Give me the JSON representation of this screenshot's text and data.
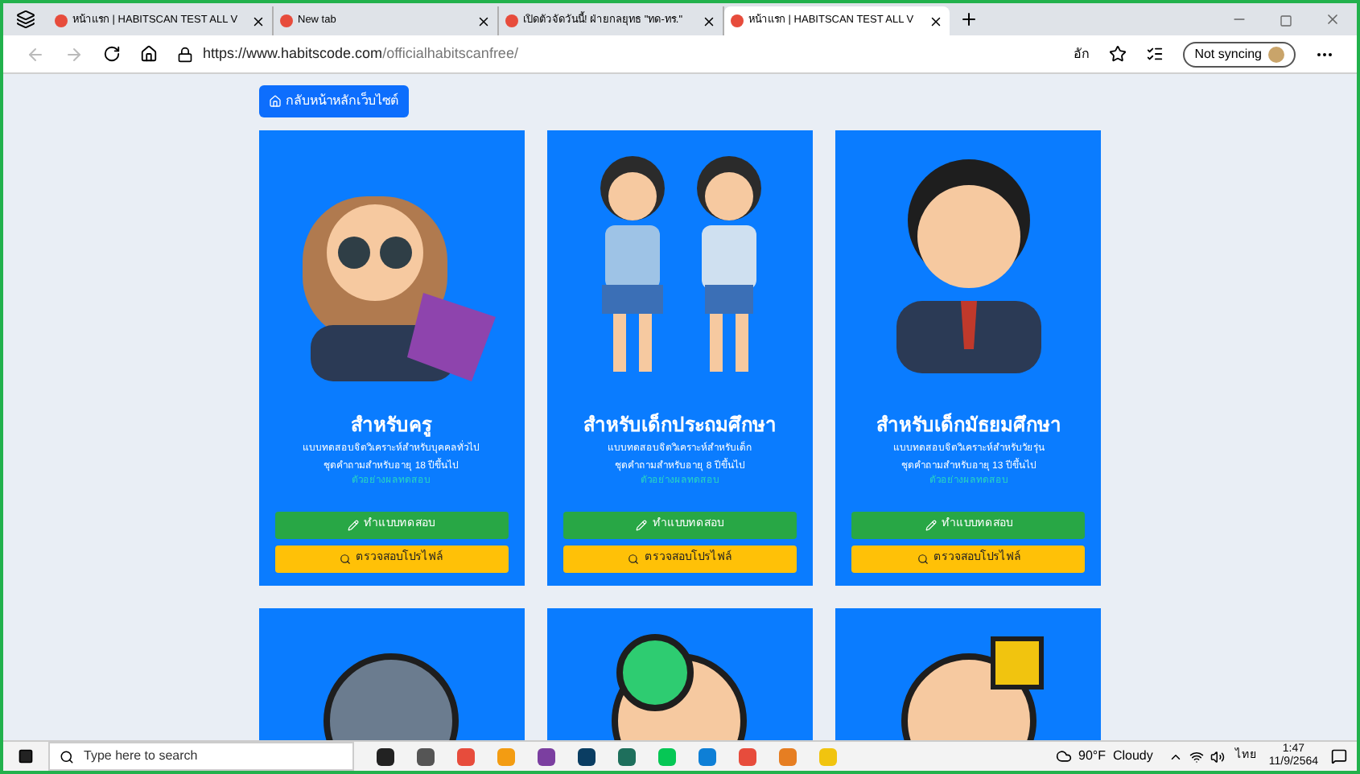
{
  "browser": {
    "tabs": [
      {
        "title": "หน้าแรก | HABITSCAN TEST ALL V",
        "selected": false
      },
      {
        "title": "New tab",
        "selected": false
      },
      {
        "title": "เปิดตัวจัดวันนี้! ฝ่ายกลยุทธ \"ทด-ทร.\"",
        "selected": false
      },
      {
        "title": "หน้าแรก | HABITSCAN TEST ALL V",
        "selected": true
      }
    ],
    "url_host": "https://www.habitscode.com",
    "url_path": "/officialhabitscanfree/",
    "sync_label": "Not syncing",
    "translate_label": "อัก"
  },
  "page": {
    "back_button": "กลับหน้าหลักเว็บไซต์",
    "cards": [
      {
        "kind": "teacher",
        "title": "สำหรับครู",
        "lines": [
          "แบบทดสอบจิตวิเคราะห์สำหรับบุคคลทั่วไป",
          "ชุดคำถามสำหรับอายุ 18 ปีขึ้นไป"
        ],
        "link": "ตัวอย่างผลทดสอบ",
        "take_button": "ทำแบบทดสอบ",
        "check_button": "ตรวจสอบโปรไฟล์"
      },
      {
        "kind": "primary",
        "title": "สำหรับเด็กประถมศึกษา",
        "lines": [
          "แบบทดสอบจิตวิเคราะห์สำหรับเด็ก",
          "ชุดคำถามสำหรับอายุ 8 ปีขึ้นไป"
        ],
        "link": "ตัวอย่างผลทดสอบ",
        "take_button": "ทำแบบทดสอบ",
        "check_button": "ตรวจสอบโปรไฟล์"
      },
      {
        "kind": "secondary",
        "title": "สำหรับเด็กมัธยมศึกษา",
        "lines": [
          "แบบทดสอบจิตวิเคราะห์สำหรับวัยรุ่น",
          "ชุดคำถามสำหรับอายุ 13 ปีขึ้นไป"
        ],
        "link": "ตัวอย่างผลทดสอบ",
        "take_button": "ทำแบบทดสอบ",
        "check_button": "ตรวจสอบโปรไฟล์"
      }
    ]
  },
  "taskbar": {
    "search_placeholder": "Type here to search",
    "weather": "90°F  Cloudy",
    "language": "ไทย",
    "time": "1:47",
    "date": "11/9/2564"
  }
}
